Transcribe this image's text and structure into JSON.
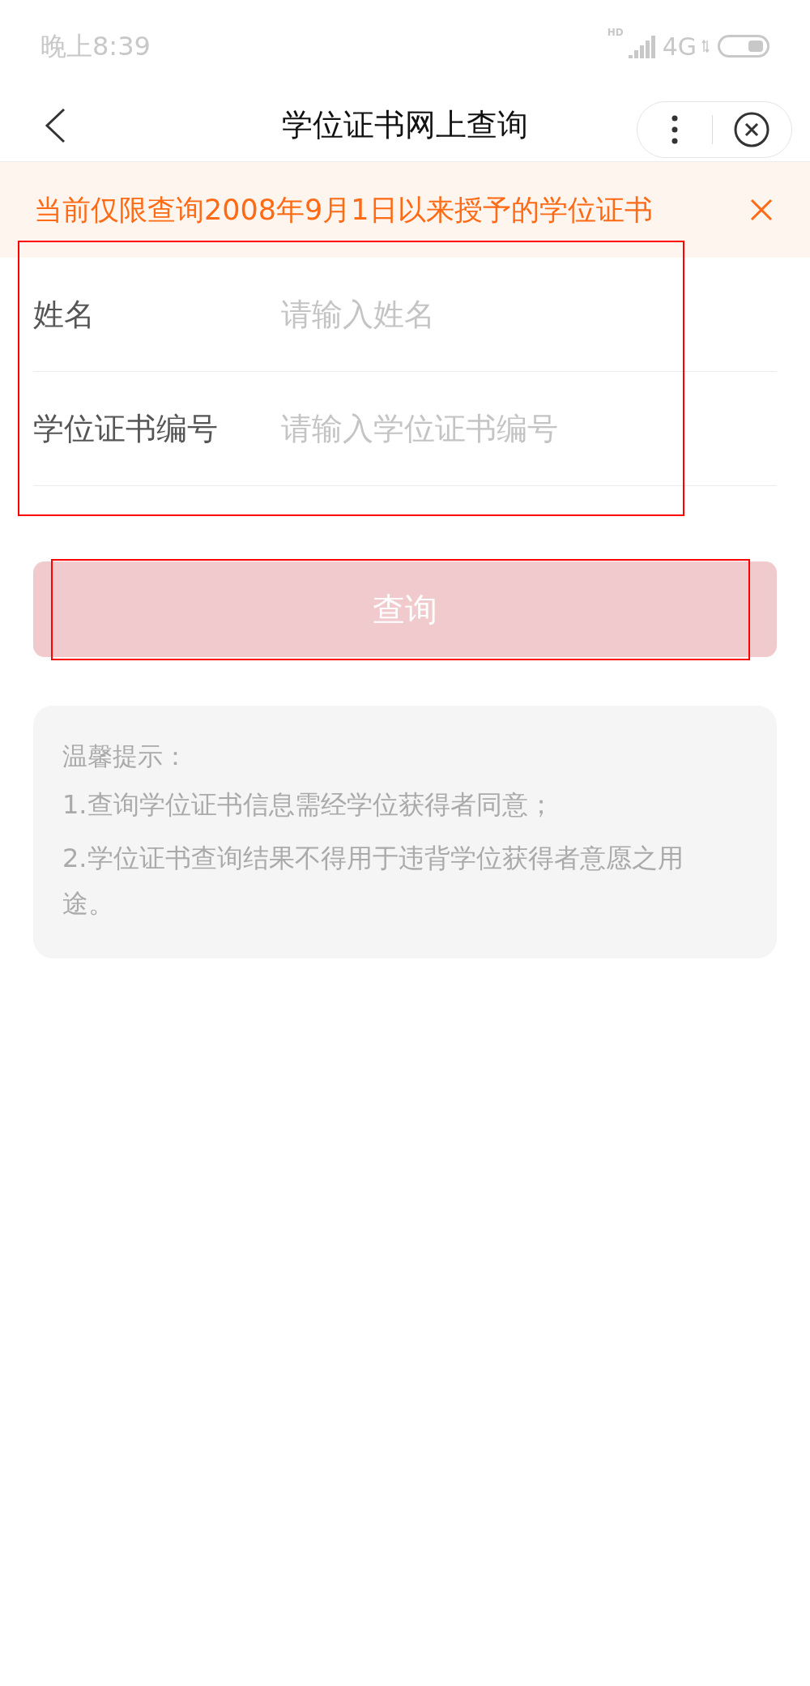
{
  "status_bar": {
    "time": "晚上8:39",
    "hd": "HD",
    "network": "4G"
  },
  "nav": {
    "title": "学位证书网上查询"
  },
  "notice": {
    "text": "当前仅限查询2008年9月1日以来授予的学位证书"
  },
  "fields": [
    {
      "label": "姓名",
      "placeholder": "请输入姓名"
    },
    {
      "label": "学位证书编号",
      "placeholder": "请输入学位证书编号"
    }
  ],
  "submit": {
    "label": "查询",
    "disabled": true
  },
  "tips": {
    "title": "温馨提示：",
    "lines": [
      "1.查询学位证书信息需经学位获得者同意；",
      "2.学位证书查询结果不得用于违背学位获得者意愿之用途。"
    ]
  },
  "annotations": [
    {
      "kind": "frame"
    },
    {
      "kind": "frame"
    }
  ]
}
